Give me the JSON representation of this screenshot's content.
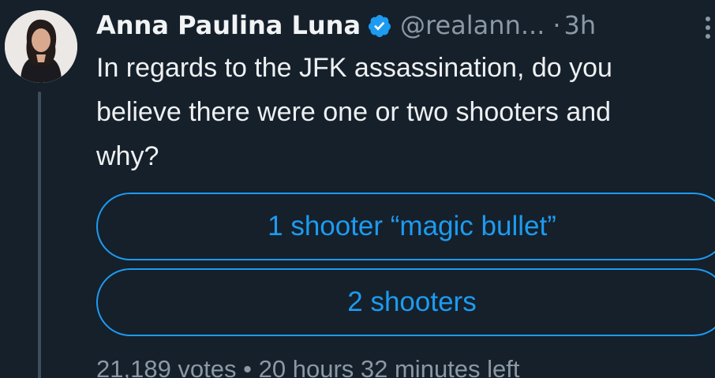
{
  "tweet": {
    "author_name": "Anna Paulina Luna",
    "handle": "@realann...",
    "separator": "·",
    "time": "3h",
    "text": "In regards to the JFK assassination, do you believe there were one or two shooters and why?",
    "verified_color": "#1d9bf0"
  },
  "poll": {
    "options": [
      {
        "label": "1 shooter “magic bullet”"
      },
      {
        "label": "2 shooters"
      }
    ],
    "votes": "21,189 votes",
    "meta_separator": "•",
    "time_left": "20 hours 32 minutes left"
  },
  "icons": {
    "verified": "verified-badge-icon",
    "more": "more-options-icon"
  }
}
